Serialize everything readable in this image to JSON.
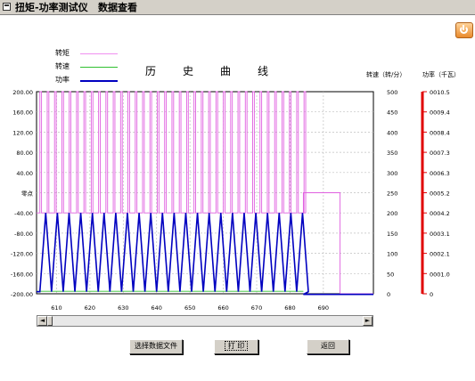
{
  "window": {
    "title": "扭矩-功率测试仪   数据查看"
  },
  "legend": [
    {
      "label": "转矩",
      "color": "#f090f0"
    },
    {
      "label": "转速",
      "color": "#30c030"
    },
    {
      "label": "功率",
      "color": "#0000c0"
    }
  ],
  "chart_title": "历史曲线",
  "right_axes": {
    "speed_title": "转速（转/分）",
    "power_title": "功率（千瓦）"
  },
  "chart_data": {
    "type": "line",
    "x_ticks": [
      "610",
      "620",
      "630",
      "640",
      "650",
      "660",
      "670",
      "680",
      "690"
    ],
    "xlim": [
      604,
      705
    ],
    "torque_axis": {
      "ticks": [
        "200.00",
        "160.00",
        "120.00",
        "80.00",
        "40.00",
        "零点",
        "-40.00",
        "-80.00",
        "-120.00",
        "-160.00",
        "-200.00"
      ],
      "ylim": [
        -200,
        200
      ]
    },
    "speed_axis": {
      "ticks": [
        "500",
        "450",
        "400",
        "350",
        "300",
        "250",
        "200",
        "150",
        "100",
        "50",
        "0"
      ],
      "ylim": [
        0,
        500
      ]
    },
    "power_axis": {
      "ticks": [
        "0010.5",
        "0009.4",
        "0008.4",
        "0007.3",
        "0006.3",
        "0005.2",
        "0004.2",
        "0003.1",
        "0002.1",
        "0001.0",
        "0"
      ],
      "ylim": [
        0,
        10.5
      ]
    },
    "series": [
      {
        "name": "转矩",
        "color": "#e060e0",
        "description_points": {
          "baseline": -40,
          "peak": 200,
          "cycles_to": 685,
          "step": [
            684,
            695,
            0
          ],
          "tail": -200
        }
      },
      {
        "name": "转速",
        "color": "#30c030",
        "baseline": 5
      },
      {
        "name": "功率",
        "color": "#0000c0",
        "low": 2,
        "high": 200,
        "cycles_to": 684,
        "after": 0
      }
    ],
    "grid": true
  },
  "scrollbar": {
    "left_arrow": "◄",
    "right_arrow": "►"
  },
  "buttons": {
    "select_file": "选择数据文件",
    "print": "打 印",
    "back": "返回"
  }
}
